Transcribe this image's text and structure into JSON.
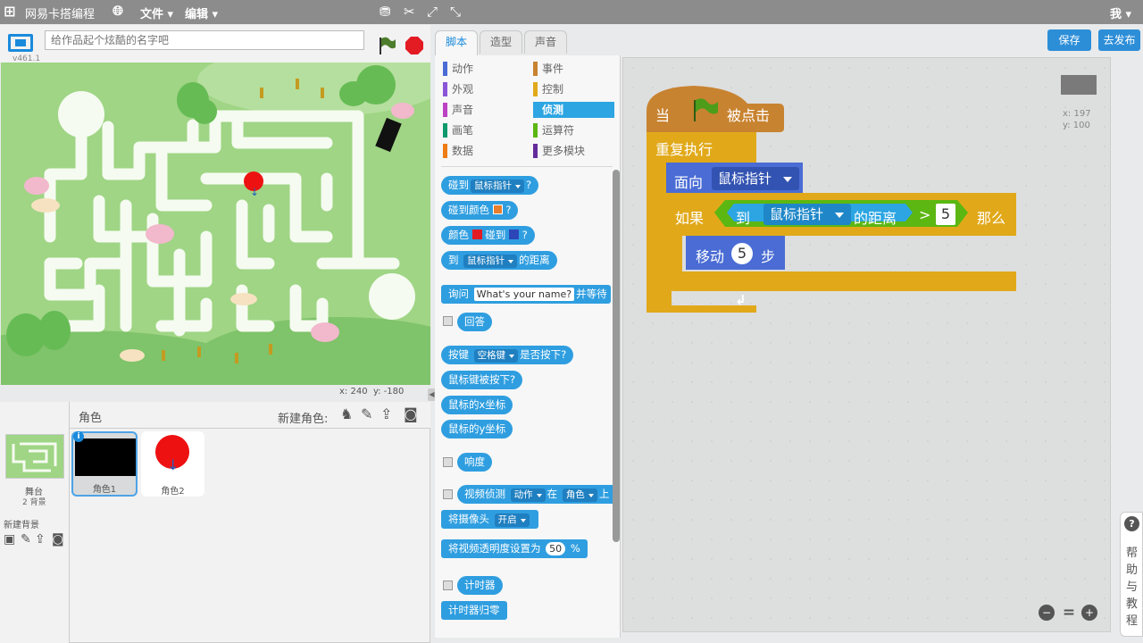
{
  "menubar": {
    "app_name": "网易卡搭编程",
    "file": "文件",
    "edit": "编辑",
    "user": "我"
  },
  "stage": {
    "title_placeholder": "给作品起个炫酷的名字吧",
    "version": "v461.1",
    "coord_x_label": "x:",
    "coord_x": "240",
    "coord_y_label": "y:",
    "coord_y": "-180"
  },
  "sprites": {
    "header": "角色",
    "new_sprite_label": "新建角色:",
    "stage_label": "舞台",
    "stage_backdrops": "2 背景",
    "new_backdrop": "新建背景",
    "items": [
      {
        "name": "角色1"
      },
      {
        "name": "角色2"
      }
    ]
  },
  "tabs": {
    "scripts": "脚本",
    "costumes": "造型",
    "sounds": "声音"
  },
  "categories": [
    {
      "label": "动作",
      "color": "#4a6cd4"
    },
    {
      "label": "事件",
      "color": "#c88330"
    },
    {
      "label": "外观",
      "color": "#8a55d7"
    },
    {
      "label": "控制",
      "color": "#e1a91a"
    },
    {
      "label": "声音",
      "color": "#bb42c3"
    },
    {
      "label": "侦测",
      "color": "#2ca5e2"
    },
    {
      "label": "画笔",
      "color": "#0e9a6c"
    },
    {
      "label": "运算符",
      "color": "#5cb712"
    },
    {
      "label": "数据",
      "color": "#ee7d16"
    },
    {
      "label": "更多模块",
      "color": "#632d99"
    }
  ],
  "palette": {
    "touching": "碰到",
    "mouse_pointer": "鼠标指针",
    "q": "?",
    "touching_color": "碰到颜色",
    "color": "颜色",
    "to": "到",
    "distance": "的距离",
    "ask": "询问",
    "ask_default": "What's your name?",
    "and_wait": "并等待",
    "answer": "回答",
    "key": "按键",
    "space_key": "空格键",
    "is_pressed": "是否按下?",
    "mouse_down": "鼠标键被按下?",
    "mouse_x": "鼠标的x坐标",
    "mouse_y": "鼠标的y坐标",
    "loudness": "响度",
    "video_detect": "视频侦测",
    "motion": "动作",
    "on": "在",
    "sprite": "角色",
    "on_end": "上",
    "turn_video": "将摄像头",
    "video_on": "开启",
    "set_transparency": "将视频透明度设置为",
    "transparency": "50",
    "percent": "%",
    "timer": "计时器",
    "reset_timer": "计时器归零"
  },
  "script": {
    "when": "当",
    "clicked": "被点击",
    "forever": "重复执行",
    "point_towards": "面向",
    "mouse_pointer": "鼠标指针",
    "if": "如果",
    "to": "到",
    "distance": "的距离",
    "gt": ">",
    "threshold": "5",
    "then": "那么",
    "move": "移动",
    "steps_value": "5",
    "steps": "步",
    "pos_x_label": "x:",
    "pos_x": "197",
    "pos_y_label": "y:",
    "pos_y": "100"
  },
  "buttons": {
    "save": "保存",
    "publish": "去发布"
  },
  "help": {
    "label": "帮助与教程"
  },
  "colors": {
    "control": "#e1a91a",
    "events": "#c88330",
    "sensing": "#2ca5e2",
    "motion": "#4a6cd4",
    "operators": "#5cb712",
    "active_tab": "#1a8adb"
  }
}
